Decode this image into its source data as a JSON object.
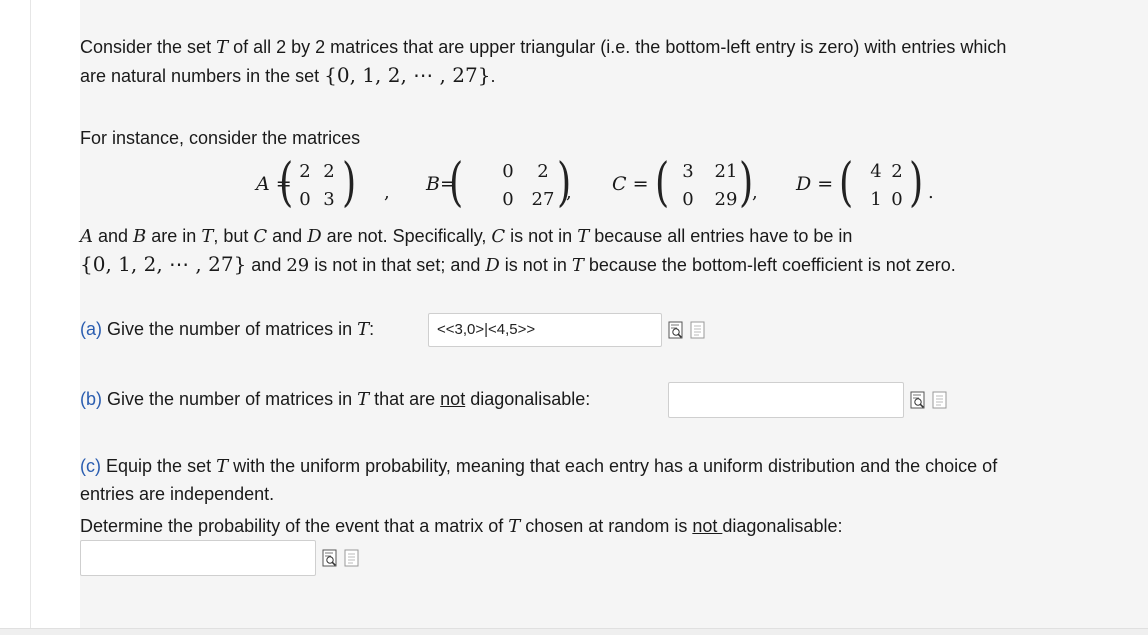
{
  "intro": {
    "line1_a": "Consider the set ",
    "T": "T",
    "line1_b": " of all 2 by 2 matrices that are upper triangular (i.e. the bottom-left entry is zero) with entries which",
    "line2_a": "are natural numbers in the set ",
    "set": "{0, 1, 2, ⋯ , 27}",
    "line2_b": "."
  },
  "instance_text": "For instance, consider the matrices",
  "matrices": [
    {
      "name": "A",
      "entries": [
        "2",
        "2",
        "0",
        "3"
      ]
    },
    {
      "name": "B",
      "entries": [
        "0",
        "2",
        "0",
        "27"
      ]
    },
    {
      "name": "C",
      "entries": [
        "3",
        "21",
        "0",
        "29"
      ]
    },
    {
      "name": "D",
      "entries": [
        "4",
        "2",
        "1",
        "0"
      ]
    }
  ],
  "explain": {
    "A": "A",
    "and": " and ",
    "B": "B",
    "p1": " are in ",
    "T": "T",
    "p2": ", but ",
    "C": "C",
    "p3": " and ",
    "D": "D",
    "p4": " are not. Specifically, ",
    "p5": " is not in ",
    "p6": " because all entries have to be in",
    "set": "{0, 1, 2, ⋯ , 27}",
    "p7": " and ",
    "n29": "29",
    "p8": " is not in that set; and ",
    "p9": " is not in ",
    "p10": " because the bottom-left coefficient is not zero."
  },
  "part_a": {
    "label": "(a)",
    "text": " Give the number of matrices in ",
    "T": "T",
    "colon": ":",
    "answer": "<<3,0>|<4,5>>"
  },
  "part_b": {
    "label": "(b)",
    "text_a": "  Give the number of matrices in ",
    "T": "T",
    "text_b": " that are ",
    "not": "not",
    "text_c": " diagonalisable:",
    "answer": ""
  },
  "part_c": {
    "label": "(c)",
    "text_a": "  Equip the set ",
    "T": "T",
    "text_b": " with the uniform probability, meaning that each entry has a uniform distribution and the choice of",
    "line2": "entries are independent.",
    "line3_a": "Determine the probability of the event that a matrix of ",
    "line3_b": " chosen at random is ",
    "not": "not ",
    "line3_c": "diagonalisable:",
    "answer": ""
  },
  "icons": [
    "preview-icon",
    "help-icon"
  ],
  "colors": {
    "label_blue": "#2a5db0",
    "panel_bg": "#f5f5f5"
  }
}
